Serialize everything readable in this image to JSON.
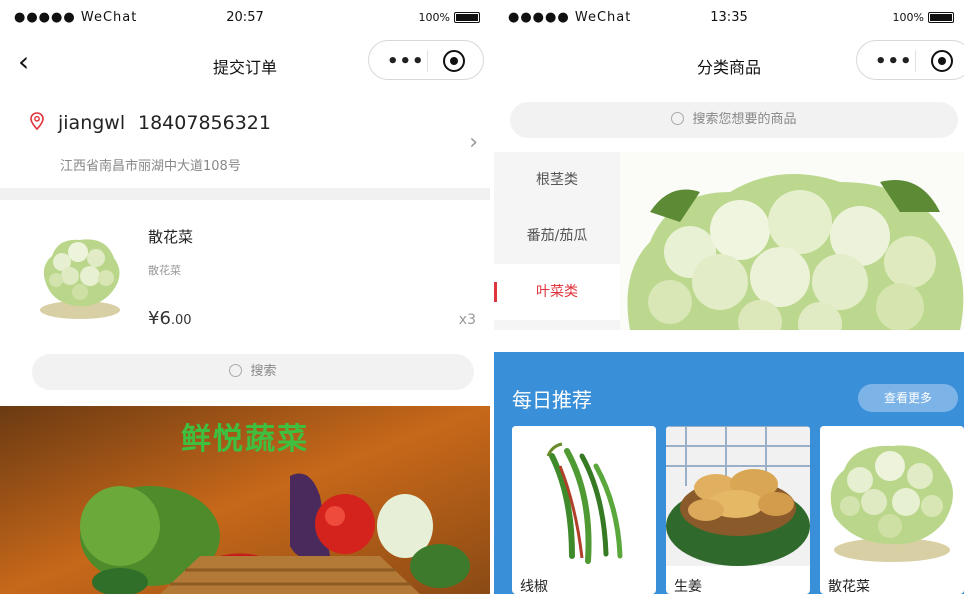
{
  "order": {
    "status": {
      "carrier": "●●●●● WeChat",
      "time": "20:57",
      "battery": "100%"
    },
    "title": "提交订单",
    "address": {
      "name": "jiangwl",
      "phone": "18407856321",
      "detail": "江西省南昌市丽湖中大道108号"
    },
    "product": {
      "name": "散花菜",
      "desc": "散花菜",
      "currency": "¥",
      "price_int": "6",
      "price_dec": ".00",
      "qty": "x3"
    }
  },
  "category": {
    "status": {
      "carrier": "●●●●● WeChat",
      "time": "13:35",
      "battery": "100%"
    },
    "title": "分类商品",
    "search_placeholder": "搜索您想要的商品",
    "items": [
      {
        "label": "根茎类",
        "active": false
      },
      {
        "label": "番茄/茄瓜",
        "active": false
      },
      {
        "label": "叶菜类",
        "active": true
      }
    ]
  },
  "home": {
    "search_placeholder": "搜索",
    "banner_title": "鲜悦蔬菜"
  },
  "daily": {
    "title": "每日推荐",
    "more_label": "查看更多",
    "cards": [
      {
        "name": "线椒"
      },
      {
        "name": "生姜"
      },
      {
        "name": "散花菜"
      }
    ]
  },
  "colors": {
    "accent_red": "#e0333b",
    "daily_blue": "#3a8fd9",
    "banner_green": "#3fbf3f"
  }
}
